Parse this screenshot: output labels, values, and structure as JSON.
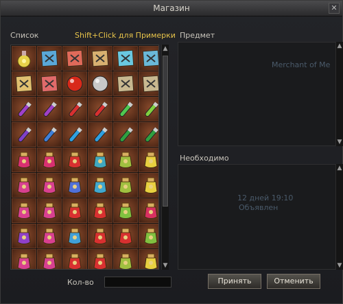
{
  "window": {
    "title": "Магазин"
  },
  "list": {
    "label": "Список",
    "hint": "Shift+Click для Примерки"
  },
  "item_panel": {
    "label": "Предмет",
    "ghost_text": "Merchant of Me"
  },
  "required_panel": {
    "label": "Необходимо",
    "ghost_date": "12 дней 19:10",
    "ghost_sub": "Объявлен"
  },
  "quantity": {
    "label": "Кол-во",
    "value": ""
  },
  "buttons": {
    "accept": "Принять",
    "cancel": "Отменить"
  },
  "icons": {
    "rows": [
      [
        "bottle-icon",
        "scroll-icon",
        "scroll-icon",
        "scroll-icon",
        "scroll-icon",
        "scroll-icon"
      ],
      [
        "scroll-icon",
        "scroll-icon",
        "red-orb-icon",
        "silver-orb-icon",
        "scroll-icon",
        "scroll-icon"
      ],
      [
        "potion-vial-icon",
        "potion-vial-icon",
        "potion-vial-icon",
        "potion-vial-icon",
        "potion-vial-icon",
        "potion-vial-icon"
      ],
      [
        "potion-vial-icon",
        "potion-vial-icon",
        "potion-vial-icon",
        "potion-vial-icon",
        "potion-vial-icon",
        "potion-vial-icon"
      ],
      [
        "jar-icon",
        "jar-icon",
        "jar-icon",
        "jar-icon",
        "jar-icon",
        "jar-icon"
      ],
      [
        "jar-icon",
        "jar-icon",
        "jar-icon",
        "jar-icon",
        "jar-icon",
        "jar-icon"
      ],
      [
        "jar-icon",
        "jar-icon",
        "jar-icon",
        "jar-icon",
        "jar-icon",
        "jar-icon"
      ],
      [
        "jar-icon",
        "jar-icon",
        "jar-icon",
        "jar-icon",
        "jar-icon",
        "jar-icon"
      ],
      [
        "jar-icon",
        "jar-icon",
        "jar-icon",
        "jar-icon",
        "jar-icon",
        "jar-icon"
      ]
    ],
    "colors": [
      [
        "#e8d24a",
        "#5aa8d8",
        "#e06a5a",
        "#d8b070",
        "#6ac8e0",
        "#6ab8d8"
      ],
      [
        "#e0c070",
        "#e06a6a",
        "#d82a1a",
        "#c8c8c8",
        "#c8b890",
        "#c8b890"
      ],
      [
        "#a040c8",
        "#a040c8",
        "#d83030",
        "#d83030",
        "#50c850",
        "#80d040"
      ],
      [
        "#8040c8",
        "#4080d8",
        "#30a0e0",
        "#30a0e0",
        "#30a040",
        "#30a040"
      ],
      [
        "#d83070",
        "#d83070",
        "#d83030",
        "#40a8c0",
        "#a0c040",
        "#e8d040"
      ],
      [
        "#d84090",
        "#d84090",
        "#5070d8",
        "#40a8d0",
        "#a0c040",
        "#e8d040"
      ],
      [
        "#d84090",
        "#d84090",
        "#d83030",
        "#d83030",
        "#80c040",
        "#d83060"
      ],
      [
        "#9040c8",
        "#d84090",
        "#40a0d8",
        "#d83030",
        "#d83030",
        "#80c040"
      ],
      [
        "#d84090",
        "#d84090",
        "#d83030",
        "#d83030",
        "#a0c040",
        "#e8d040"
      ]
    ]
  }
}
